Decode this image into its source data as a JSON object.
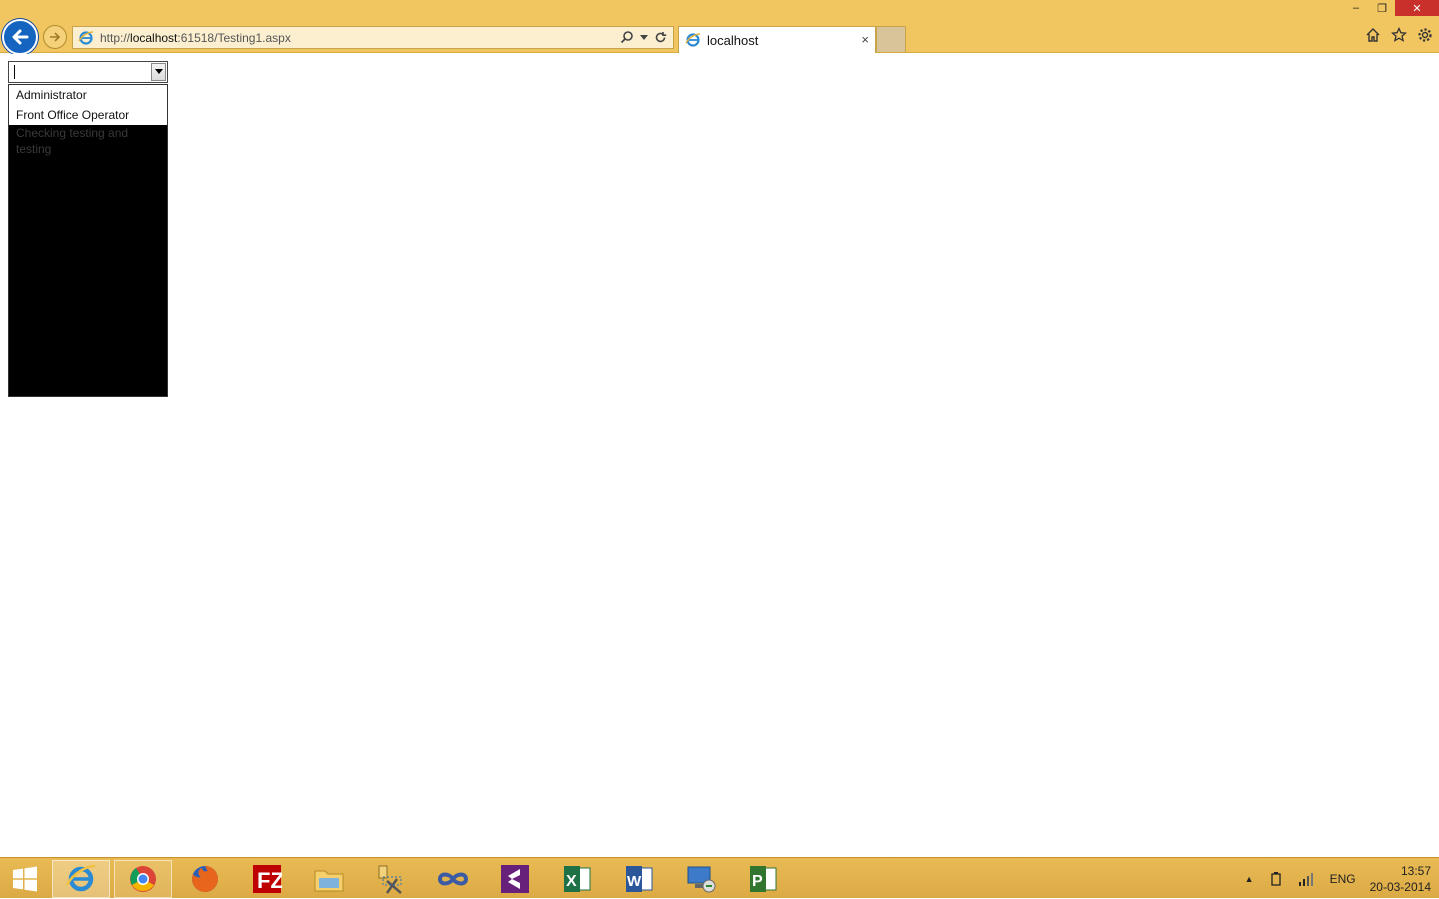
{
  "browser": {
    "url_prefix": "http://",
    "url_host": "localhost",
    "url_rest": ":61518/Testing1.aspx",
    "tab_title": "localhost",
    "tab_close": "×",
    "accent_color": "#f1c660"
  },
  "window_controls": {
    "minimize": "–",
    "restore": "❐",
    "close": "✕"
  },
  "combo": {
    "value": "",
    "options": [
      "Administrator",
      "Front Office Operator",
      "Checking testing and testing"
    ]
  },
  "taskbar": {
    "apps": [
      "windows-start",
      "internet-explorer",
      "chrome",
      "firefox",
      "filezilla",
      "file-explorer",
      "tools",
      "infinity-app",
      "visual-studio",
      "excel",
      "word",
      "remote-desktop",
      "project"
    ],
    "tray_language": "ENG",
    "tray_arrow": "▲",
    "time": "13:57",
    "date": "20-03-2014"
  }
}
